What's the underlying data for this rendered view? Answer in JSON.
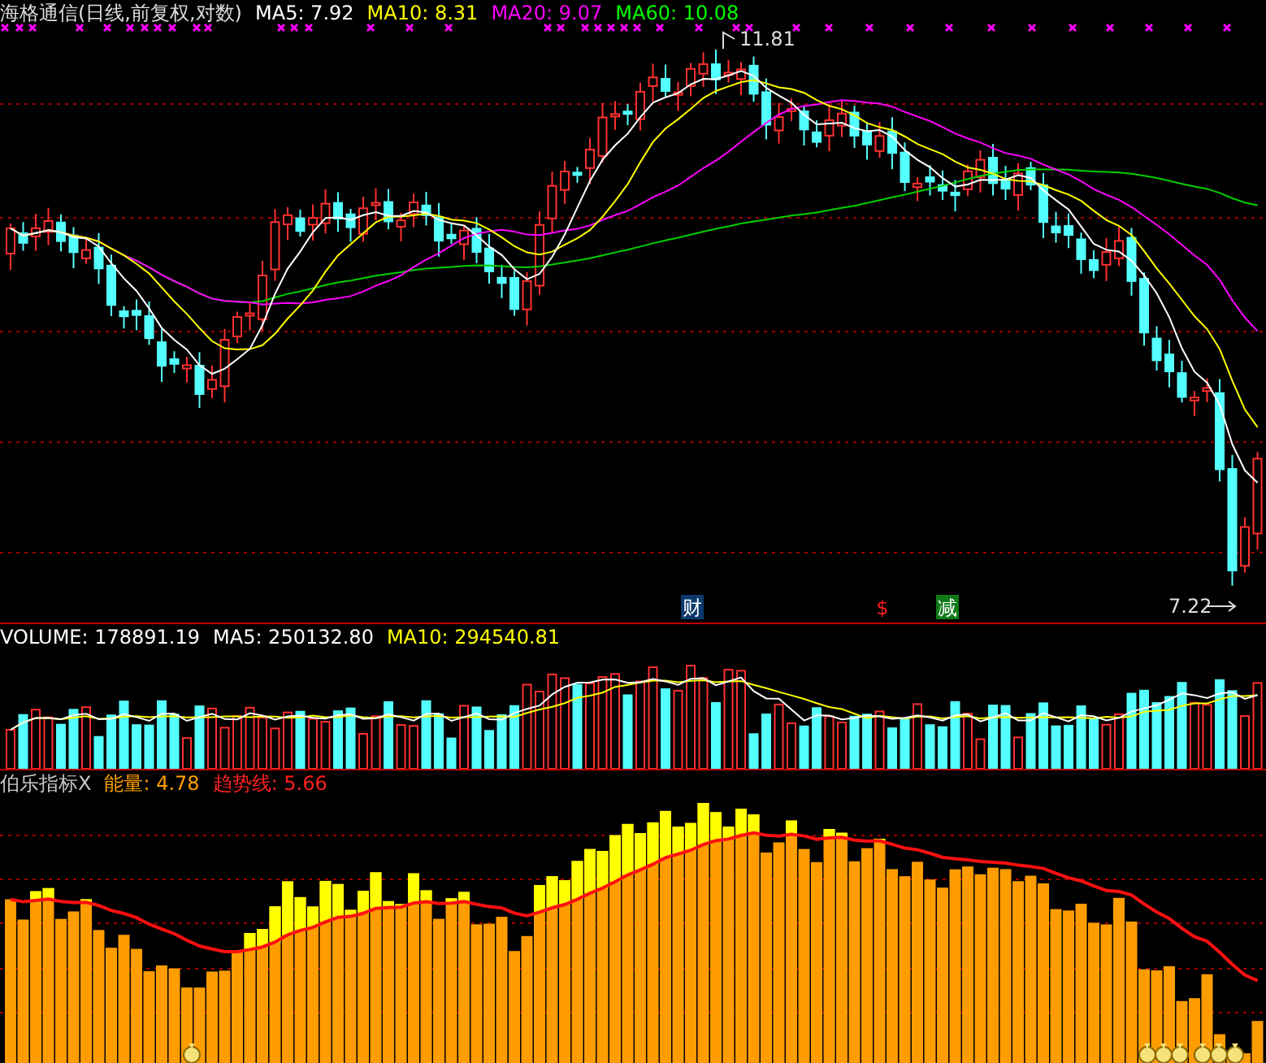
{
  "price_panel": {
    "title": "海格通信(日线,前复权,对数)",
    "averages": [
      {
        "label": "MA5: 7.92",
        "color": "#ffffff"
      },
      {
        "label": "MA10: 8.31",
        "color": "#ffff00"
      },
      {
        "label": "MA20: 9.07",
        "color": "#ff00ff"
      },
      {
        "label": "MA60: 10.08",
        "color": "#00ff00"
      }
    ],
    "high_label": "11.81",
    "low_label": "7.22",
    "events": [
      {
        "text": "财",
        "kind": "badge",
        "color": "#0d3a6e"
      },
      {
        "text": "$",
        "kind": "plain",
        "color": "#ff2020"
      },
      {
        "text": "减",
        "kind": "badge",
        "color": "#0f7a16"
      }
    ]
  },
  "volume_panel": {
    "items": [
      {
        "label": "VOLUME: 178891.19",
        "color": "#ffffff"
      },
      {
        "label": "MA5: 250132.80",
        "color": "#ffffff"
      },
      {
        "label": "MA10: 294540.81",
        "color": "#ffff00"
      }
    ]
  },
  "indicator_panel": {
    "items": [
      {
        "label": "伯乐指标X",
        "color": "#c8c8c8"
      },
      {
        "label": "能量: 4.78",
        "color": "#ffa000"
      },
      {
        "label": "趋势线: 5.66",
        "color": "#ff2020"
      }
    ]
  }
}
